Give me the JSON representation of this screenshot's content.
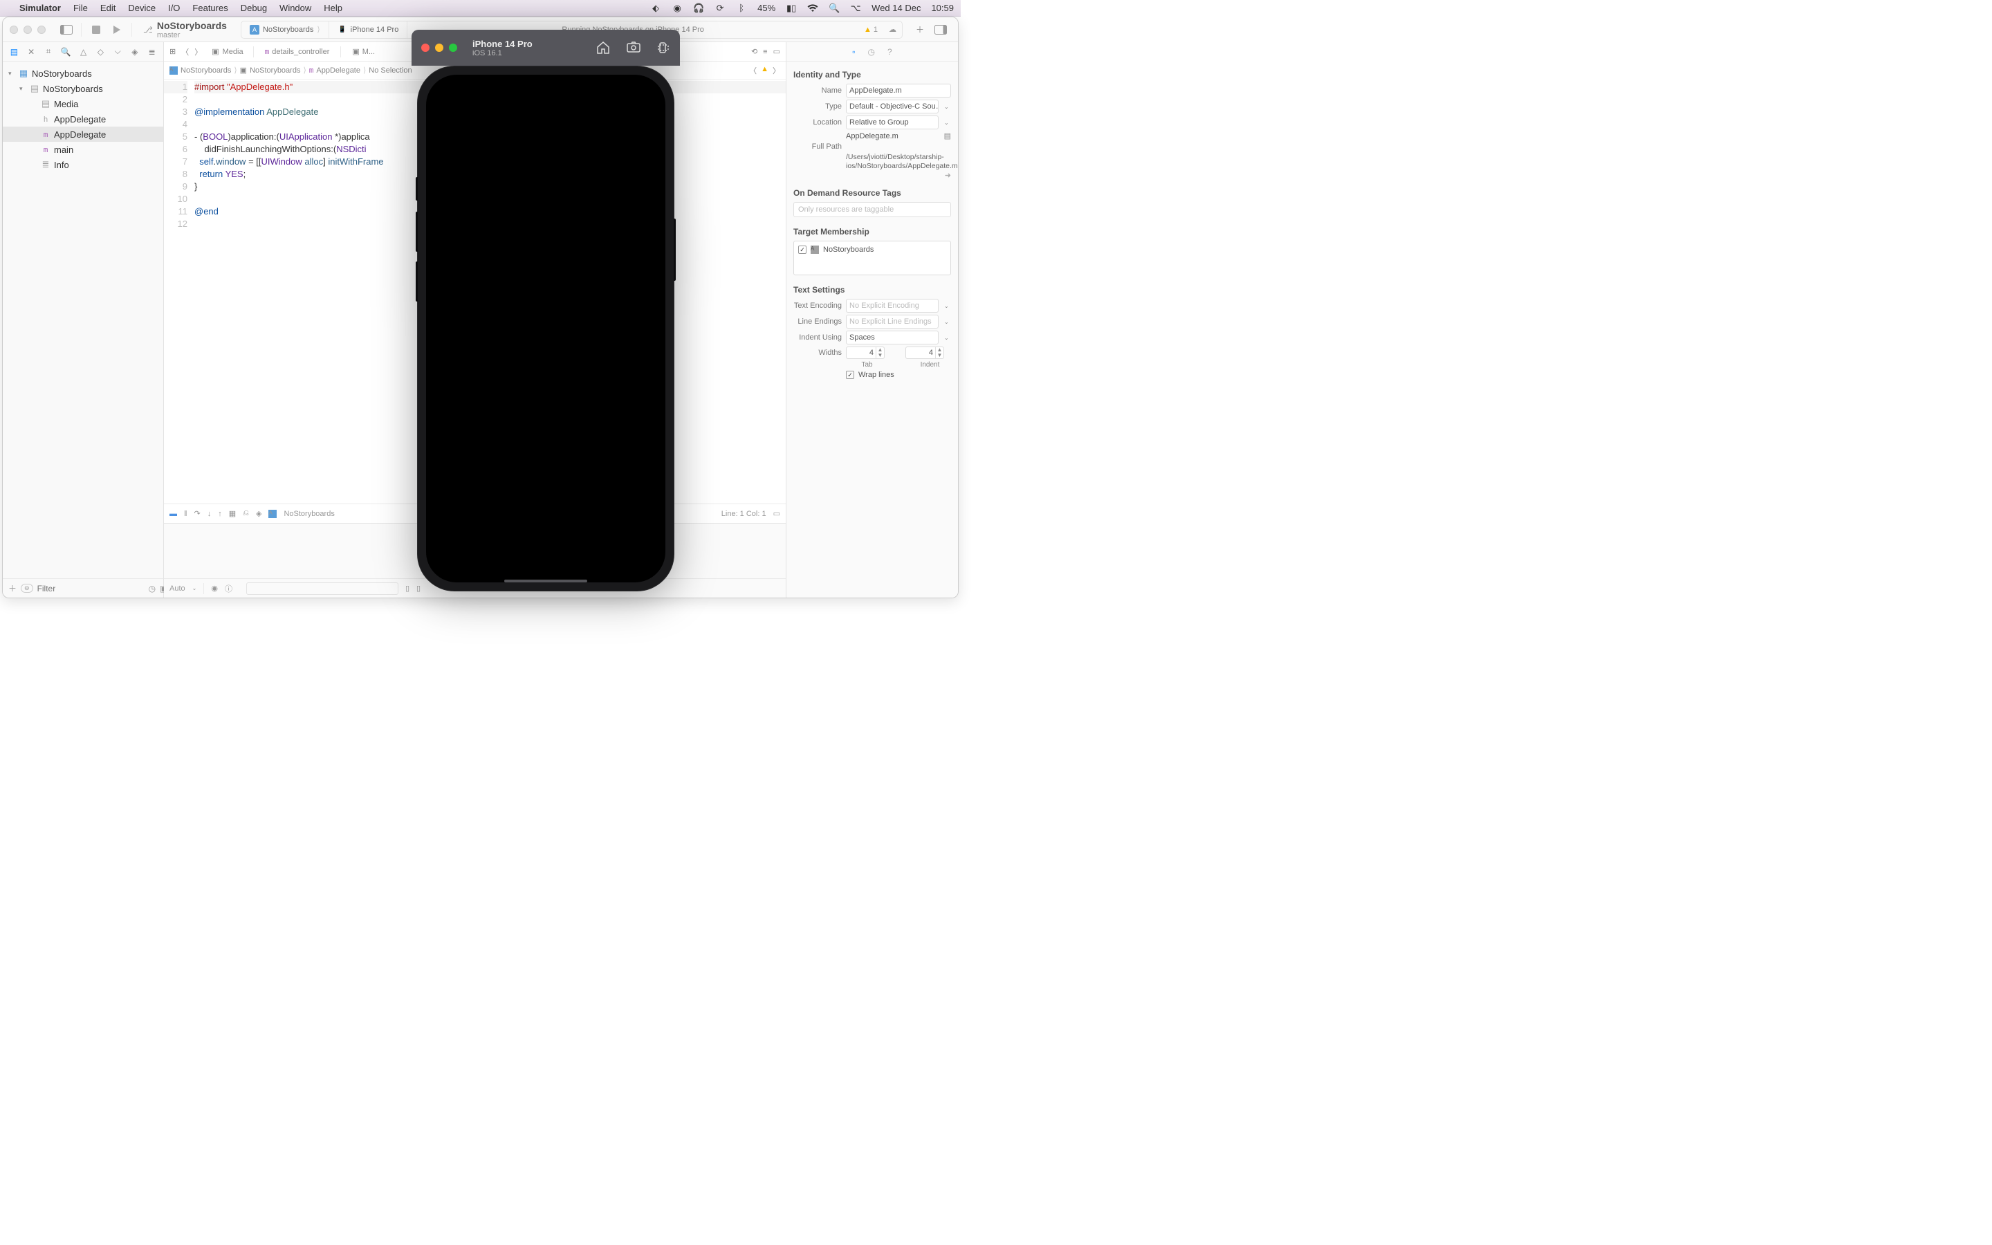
{
  "menubar": {
    "app": "Simulator",
    "items": [
      "File",
      "Edit",
      "Device",
      "I/O",
      "Features",
      "Debug",
      "Window",
      "Help"
    ],
    "battery": "45%",
    "date": "Wed 14 Dec",
    "time": "10:59"
  },
  "xcode": {
    "toolbar": {
      "project": "NoStoryboards",
      "branch": "master",
      "tabbar": [
        {
          "icon": "app",
          "label": "NoStoryboards"
        },
        {
          "icon": "device",
          "label": "iPhone 14 Pro"
        }
      ],
      "status": "Running NoStoryboards on iPhone 14 Pro",
      "warn_count": "1"
    },
    "navigator": {
      "scheme": "Media",
      "open_tabs": [
        "details_controller",
        "M..."
      ],
      "tree": [
        {
          "depth": 0,
          "disclosure": "▾",
          "icon": "proj",
          "label": "NoStoryboards"
        },
        {
          "depth": 1,
          "disclosure": "▾",
          "icon": "folder",
          "label": "NoStoryboards"
        },
        {
          "depth": 2,
          "disclosure": "",
          "icon": "folder",
          "label": "Media"
        },
        {
          "depth": 2,
          "disclosure": "",
          "icon": "h",
          "label": "AppDelegate"
        },
        {
          "depth": 2,
          "disclosure": "",
          "icon": "m",
          "label": "AppDelegate",
          "sel": true
        },
        {
          "depth": 2,
          "disclosure": "",
          "icon": "m",
          "label": "main"
        },
        {
          "depth": 2,
          "disclosure": "",
          "icon": "plist",
          "label": "Info"
        }
      ],
      "filter_placeholder": "Filter"
    },
    "editor": {
      "crumbs": [
        "NoStoryboards",
        "NoStoryboards",
        "AppDelegate",
        "No Selection"
      ],
      "icons_crumb": [
        "app",
        "folder",
        "m",
        ""
      ],
      "code_lines": [
        {
          "n": "1",
          "html": "<span class='kw1'>#import</span> <span class='str'>\"AppDelegate.h\"</span>"
        },
        {
          "n": "2",
          "html": ""
        },
        {
          "n": "3",
          "html": "<span class='kw2'>@implementation</span> <span class='type'>AppDelegate</span>"
        },
        {
          "n": "4",
          "html": ""
        },
        {
          "n": "5",
          "html": "- (<span class='cls'>BOOL</span>)application:(<span class='cls'>UIApplication</span> *)applica"
        },
        {
          "n": "6",
          "html": "    didFinishLaunchingWithOptions:(<span class='cls'>NSDicti</span>"
        },
        {
          "n": "7",
          "html": "  <span class='kw2'>self</span>.<span class='msg'>window</span> = [[<span class='cls'>UIWindow</span> <span class='msg'>alloc</span>] <span class='msg'>initWithFrame</span>"
        },
        {
          "n": "8",
          "html": "  <span class='kw2'>return</span> <span class='cls'>YES</span>;"
        },
        {
          "n": "9",
          "html": "}"
        },
        {
          "n": "10",
          "html": ""
        },
        {
          "n": "11",
          "html": "<span class='kw2'>@end</span>"
        },
        {
          "n": "12",
          "html": ""
        }
      ],
      "status": "Line: 1  Col: 1",
      "debug_target": "NoStoryboards",
      "auto": "Auto"
    },
    "inspector": {
      "sections": {
        "identity": "Identity and Type",
        "name_label": "Name",
        "name_value": "AppDelegate.m",
        "type_label": "Type",
        "type_value": "Default - Objective-C Sou…",
        "location_label": "Location",
        "location_value": "Relative to Group",
        "location_file": "AppDelegate.m",
        "fullpath_label": "Full Path",
        "fullpath_value": "/Users/jviotti/Desktop/starship-ios/NoStoryboards/AppDelegate.m",
        "odr": "On Demand Resource Tags",
        "odr_placeholder": "Only resources are taggable",
        "tm": "Target Membership",
        "tm_target": "NoStoryboards",
        "ts": "Text Settings",
        "enc_label": "Text Encoding",
        "enc_value": "No Explicit Encoding",
        "le_label": "Line Endings",
        "le_value": "No Explicit Line Endings",
        "indent_label": "Indent Using",
        "indent_value": "Spaces",
        "widths_label": "Widths",
        "tab_value": "4",
        "indent_width_value": "4",
        "tab_caption": "Tab",
        "indent_caption": "Indent",
        "wrap": "Wrap lines"
      }
    }
  },
  "simulator": {
    "title": "iPhone 14 Pro",
    "subtitle": "iOS 16.1"
  }
}
